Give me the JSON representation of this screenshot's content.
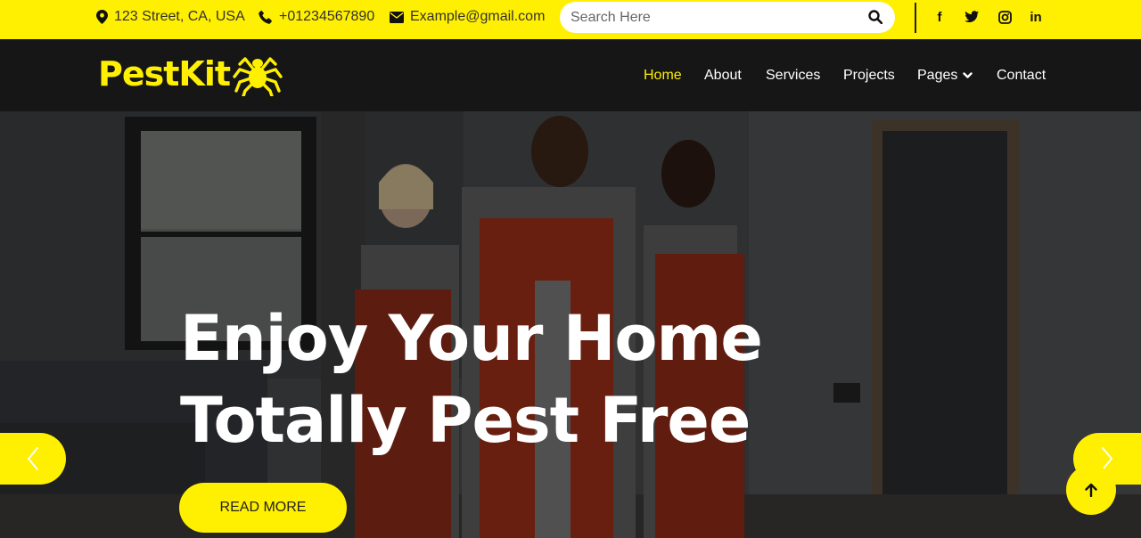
{
  "topbar": {
    "address": "123 Street, CA, USA",
    "phone": "+01234567890",
    "email": "Example@gmail.com",
    "search_placeholder": "Search Here",
    "socials": [
      "facebook-icon",
      "twitter-icon",
      "instagram-icon",
      "linkedin-icon"
    ],
    "social_labels": {
      "facebook": "f",
      "linkedin": "in"
    }
  },
  "brand": {
    "name": "PestKit",
    "icon": "spider-icon"
  },
  "nav": {
    "items": [
      {
        "label": "Home",
        "active": true
      },
      {
        "label": "About"
      },
      {
        "label": "Services"
      },
      {
        "label": "Projects"
      },
      {
        "label": "Pages"
      },
      {
        "label": "Contact"
      }
    ]
  },
  "hero": {
    "headline_line1": "Enjoy Your Home",
    "headline_line2": "Totally Pest Free",
    "cta_label": "READ MORE"
  },
  "colors": {
    "accent": "#ffef00",
    "navbar": "#161616",
    "text_dark": "#222222"
  }
}
